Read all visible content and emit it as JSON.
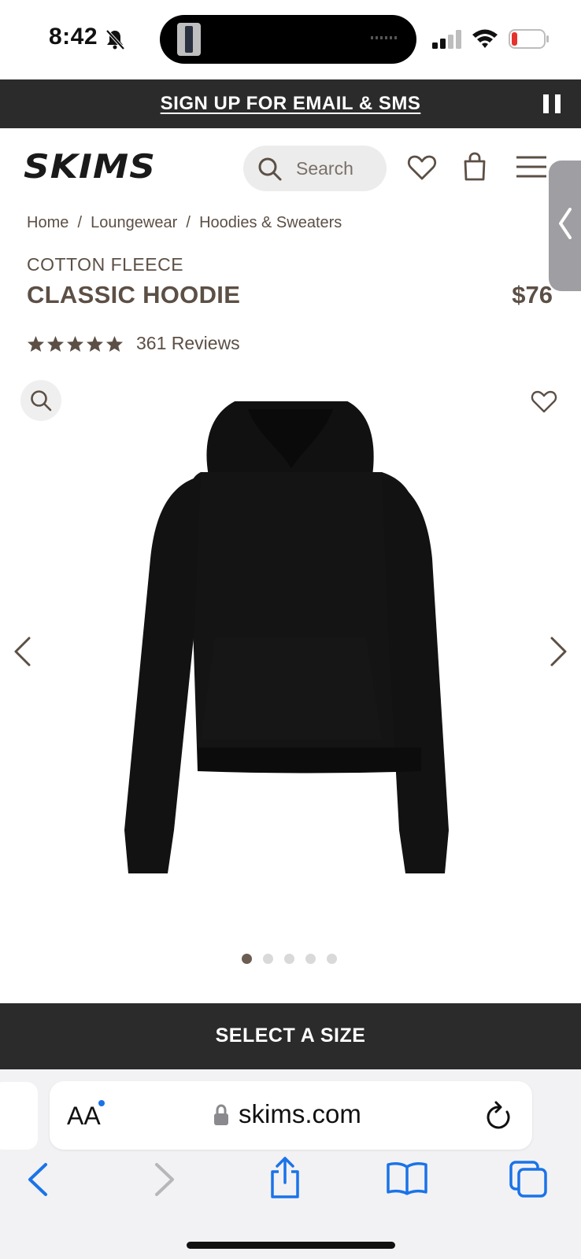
{
  "status_bar": {
    "time": "8:42"
  },
  "promo": {
    "text": "SIGN UP FOR EMAIL & SMS"
  },
  "header": {
    "brand": "SKIMS",
    "search_placeholder": "Search"
  },
  "breadcrumb": {
    "items": [
      "Home",
      "Loungewear",
      "Hoodies & Sweaters"
    ],
    "separator": "/"
  },
  "product": {
    "collection": "COTTON FLEECE",
    "name": "CLASSIC HOODIE",
    "price": "$76",
    "rating_stars": 5,
    "reviews": "361 Reviews",
    "image_count": 5,
    "active_image_index": 0,
    "cta": "SELECT A SIZE"
  },
  "browser": {
    "text_size_label": "AA",
    "url": "skims.com"
  },
  "colors": {
    "brand_brown": "#5c4f45",
    "dark_bar": "#2b2b2b",
    "ios_blue": "#1a73e8"
  },
  "icons": [
    "mute-icon",
    "signal-icon",
    "wifi-icon",
    "battery-icon",
    "pause-icon",
    "search-icon",
    "heart-icon",
    "bag-icon",
    "menu-icon",
    "zoom-icon",
    "chevron-left-icon",
    "chevron-right-icon",
    "lock-icon",
    "reload-icon",
    "share-icon",
    "bookmarks-icon",
    "tabs-icon"
  ]
}
